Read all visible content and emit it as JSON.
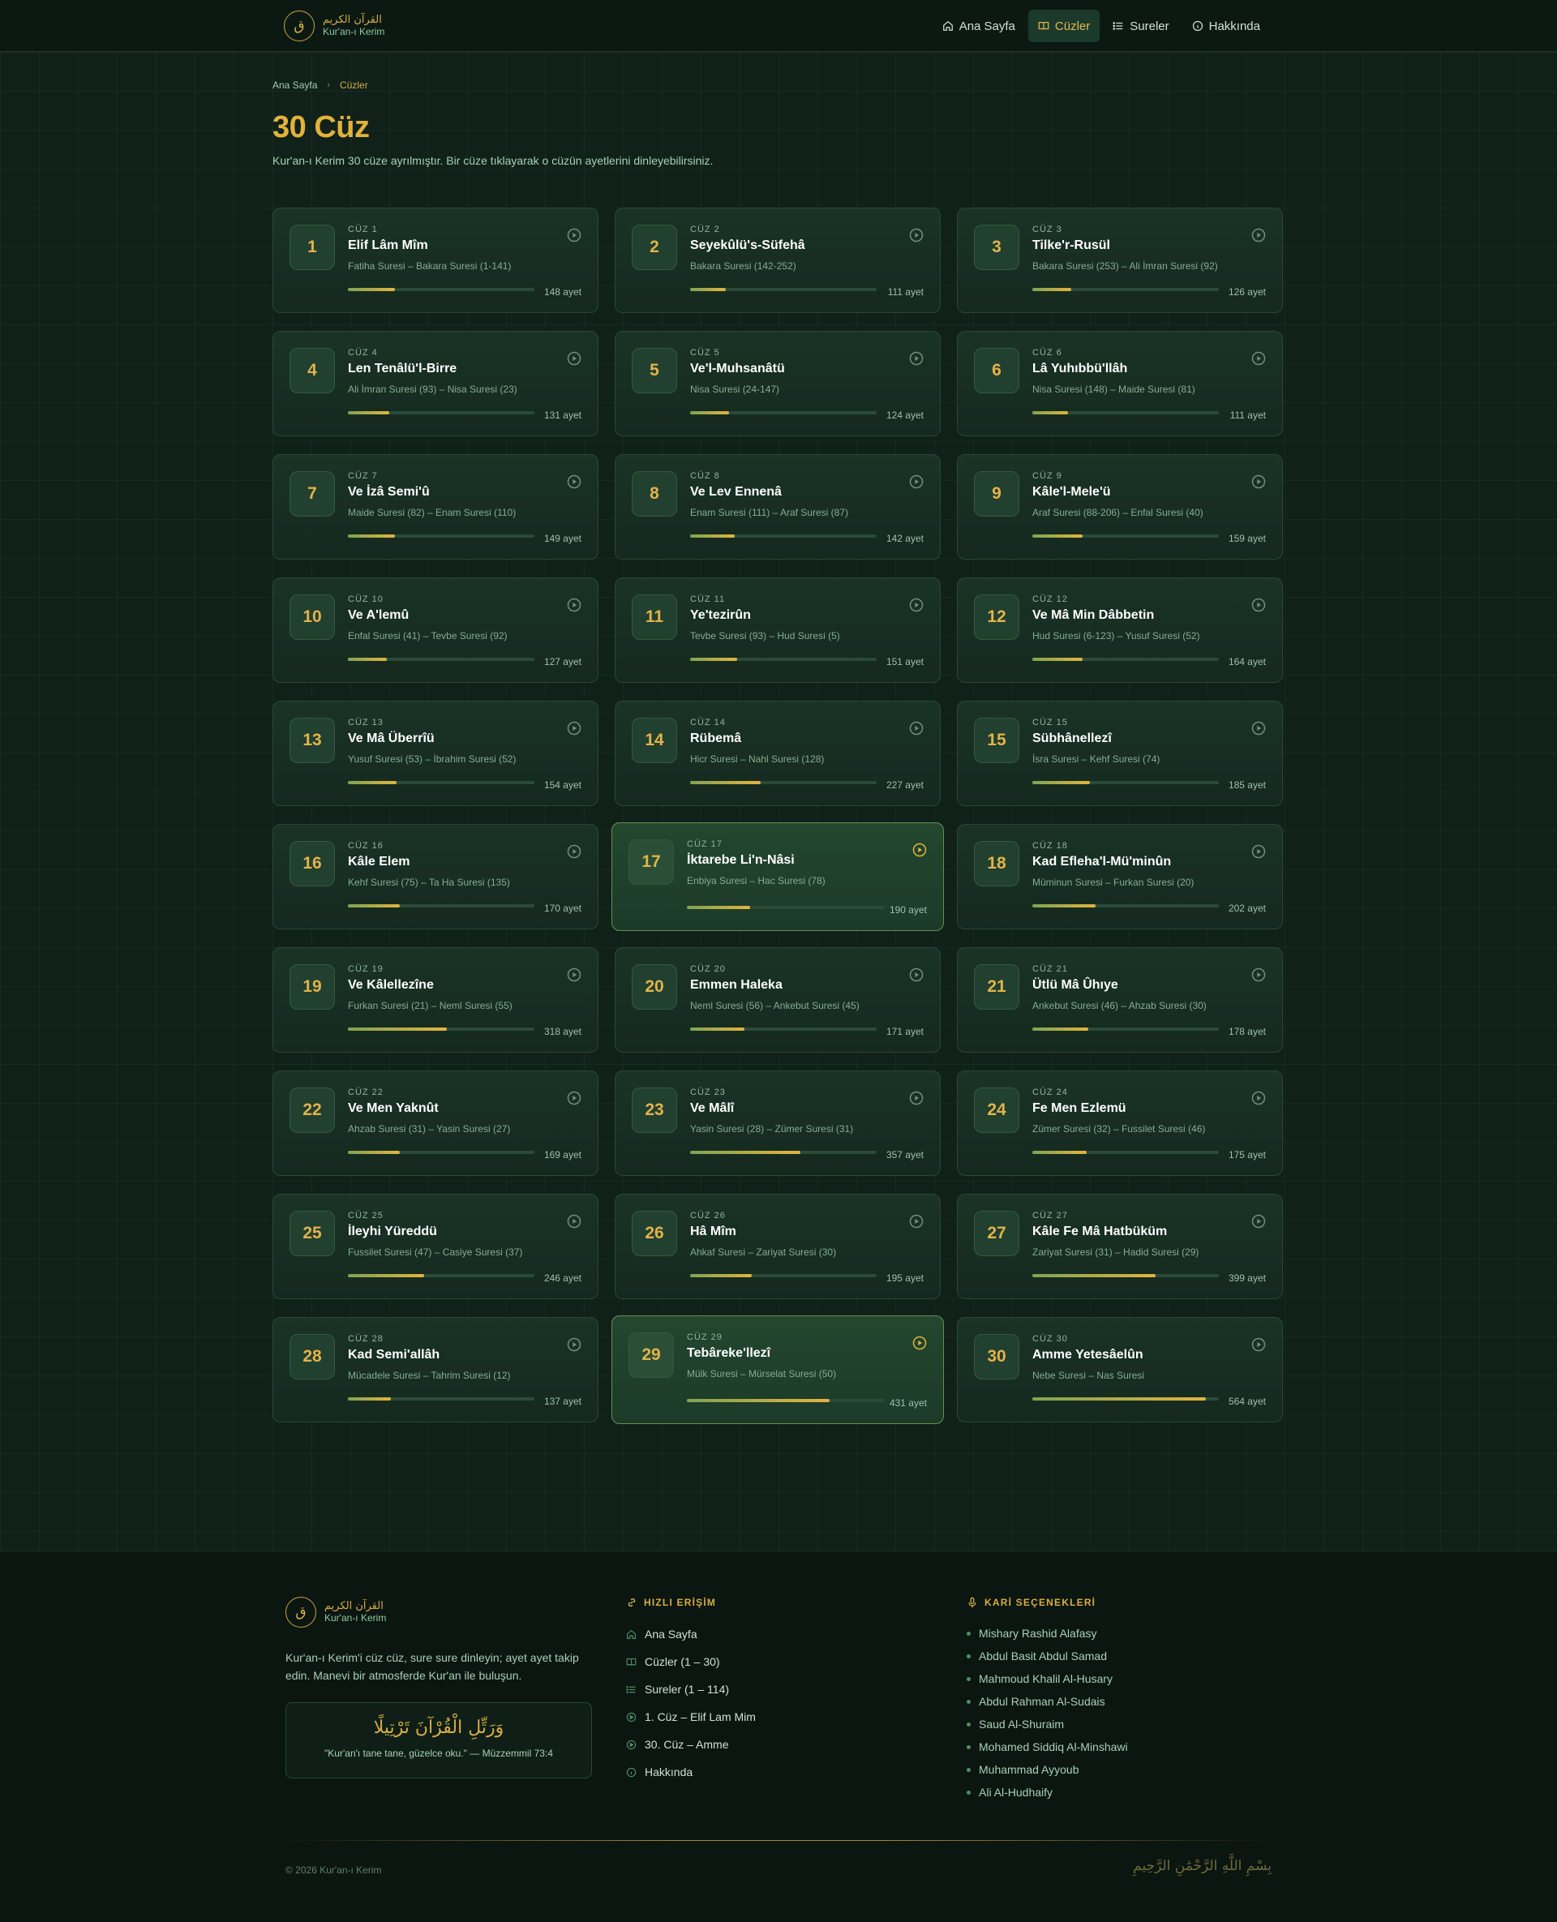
{
  "header": {
    "logo_letter": "ق",
    "brand_ar": "القرآن الكريم",
    "brand_tr": "Kur'an-ı Kerim",
    "nav": [
      {
        "label": "Ana Sayfa",
        "icon": "home-icon",
        "active": false
      },
      {
        "label": "Cüzler",
        "icon": "book-icon",
        "active": true
      },
      {
        "label": "Sureler",
        "icon": "list-icon",
        "active": false
      },
      {
        "label": "Hakkında",
        "icon": "info-icon",
        "active": false
      }
    ]
  },
  "breadcrumb": {
    "home": "Ana Sayfa",
    "separator": "›",
    "current": "Cüzler"
  },
  "page": {
    "title": "30 Cüz",
    "subtitle": "Kur'an-ı Kerim 30 cüze ayrılmıştır. Bir cüze tıklayarak o cüzün ayetlerini dinleyebilirsiniz."
  },
  "cuz_list": [
    {
      "number": "1",
      "label": "CÜZ 1",
      "name": "Elif Lâm Mîm",
      "range": "Fatiha Suresi – Bakara Suresi (1-141)",
      "ayet": "148 ayet",
      "progress": 0.25
    },
    {
      "number": "2",
      "label": "CÜZ 2",
      "name": "Seyekûlü's-Süfehâ",
      "range": "Bakara Suresi (142-252)",
      "ayet": "111 ayet",
      "progress": 0.19
    },
    {
      "number": "3",
      "label": "CÜZ 3",
      "name": "Tilke'r-Rusül",
      "range": "Bakara Suresi (253) – Ali İmran Suresi (92)",
      "ayet": "126 ayet",
      "progress": 0.21
    },
    {
      "number": "4",
      "label": "CÜZ 4",
      "name": "Len Tenâlü'l-Birre",
      "range": "Ali İmran Suresi (93) – Nisa Suresi (23)",
      "ayet": "131 ayet",
      "progress": 0.22
    },
    {
      "number": "5",
      "label": "CÜZ 5",
      "name": "Ve'l-Muhsanâtü",
      "range": "Nisa Suresi (24-147)",
      "ayet": "124 ayet",
      "progress": 0.21
    },
    {
      "number": "6",
      "label": "CÜZ 6",
      "name": "Lâ Yuhıbbü'llâh",
      "range": "Nisa Suresi (148) – Maide Suresi (81)",
      "ayet": "111 ayet",
      "progress": 0.19
    },
    {
      "number": "7",
      "label": "CÜZ 7",
      "name": "Ve İzâ Semi'û",
      "range": "Maide Suresi (82) – Enam Suresi (110)",
      "ayet": "149 ayet",
      "progress": 0.25
    },
    {
      "number": "8",
      "label": "CÜZ 8",
      "name": "Ve Lev Ennenâ",
      "range": "Enam Suresi (111) – Araf Suresi (87)",
      "ayet": "142 ayet",
      "progress": 0.24
    },
    {
      "number": "9",
      "label": "CÜZ 9",
      "name": "Kâle'l-Mele'ü",
      "range": "Araf Suresi (88-206) – Enfal Suresi (40)",
      "ayet": "159 ayet",
      "progress": 0.27
    },
    {
      "number": "10",
      "label": "CÜZ 10",
      "name": "Ve A'lemû",
      "range": "Enfal Suresi (41) – Tevbe Suresi (92)",
      "ayet": "127 ayet",
      "progress": 0.21
    },
    {
      "number": "11",
      "label": "CÜZ 11",
      "name": "Ye'tezirûn",
      "range": "Tevbe Suresi (93) – Hud Suresi (5)",
      "ayet": "151 ayet",
      "progress": 0.25
    },
    {
      "number": "12",
      "label": "CÜZ 12",
      "name": "Ve Mâ Min Dâbbetin",
      "range": "Hud Suresi (6-123) – Yusuf Suresi (52)",
      "ayet": "164 ayet",
      "progress": 0.27
    },
    {
      "number": "13",
      "label": "CÜZ 13",
      "name": "Ve Mâ Überrîü",
      "range": "Yusuf Suresi (53) – İbrahim Suresi (52)",
      "ayet": "154 ayet",
      "progress": 0.26
    },
    {
      "number": "14",
      "label": "CÜZ 14",
      "name": "Rübemâ",
      "range": "Hicr Suresi – Nahl Suresi (128)",
      "ayet": "227 ayet",
      "progress": 0.38
    },
    {
      "number": "15",
      "label": "CÜZ 15",
      "name": "Sübhânellezî",
      "range": "İsra Suresi – Kehf Suresi (74)",
      "ayet": "185 ayet",
      "progress": 0.31
    },
    {
      "number": "16",
      "label": "CÜZ 16",
      "name": "Kâle Elem",
      "range": "Kehf Suresi (75) – Ta Ha Suresi (135)",
      "ayet": "170 ayet",
      "progress": 0.28
    },
    {
      "number": "17",
      "label": "CÜZ 17",
      "name": "İktarebe Li'n-Nâsi",
      "range": "Enbiya Suresi – Hac Suresi (78)",
      "ayet": "190 ayet",
      "progress": 0.32,
      "active": true
    },
    {
      "number": "18",
      "label": "CÜZ 18",
      "name": "Kad Efleha'l-Mü'minûn",
      "range": "Müminun Suresi – Furkan Suresi (20)",
      "ayet": "202 ayet",
      "progress": 0.34
    },
    {
      "number": "19",
      "label": "CÜZ 19",
      "name": "Ve Kâlellezîne",
      "range": "Furkan Suresi (21) – Neml Suresi (55)",
      "ayet": "318 ayet",
      "progress": 0.53
    },
    {
      "number": "20",
      "label": "CÜZ 20",
      "name": "Emmen Haleka",
      "range": "Neml Suresi (56) – Ankebut Suresi (45)",
      "ayet": "171 ayet",
      "progress": 0.29
    },
    {
      "number": "21",
      "label": "CÜZ 21",
      "name": "Ütlü Mâ Ûhıye",
      "range": "Ankebut Suresi (46) – Ahzab Suresi (30)",
      "ayet": "178 ayet",
      "progress": 0.3
    },
    {
      "number": "22",
      "label": "CÜZ 22",
      "name": "Ve Men Yaknût",
      "range": "Ahzab Suresi (31) – Yasin Suresi (27)",
      "ayet": "169 ayet",
      "progress": 0.28
    },
    {
      "number": "23",
      "label": "CÜZ 23",
      "name": "Ve Mâlî",
      "range": "Yasin Suresi (28) – Zümer Suresi (31)",
      "ayet": "357 ayet",
      "progress": 0.59
    },
    {
      "number": "24",
      "label": "CÜZ 24",
      "name": "Fe Men Ezlemü",
      "range": "Zümer Suresi (32) – Fussilet Suresi (46)",
      "ayet": "175 ayet",
      "progress": 0.29
    },
    {
      "number": "25",
      "label": "CÜZ 25",
      "name": "İleyhi Yüreddü",
      "range": "Fussilet Suresi (47) – Casiye Suresi (37)",
      "ayet": "246 ayet",
      "progress": 0.41
    },
    {
      "number": "26",
      "label": "CÜZ 26",
      "name": "Hâ Mîm",
      "range": "Ahkaf Suresi – Zariyat Suresi (30)",
      "ayet": "195 ayet",
      "progress": 0.33
    },
    {
      "number": "27",
      "label": "CÜZ 27",
      "name": "Kâle Fe Mâ Hatbüküm",
      "range": "Zariyat Suresi (31) – Hadid Suresi (29)",
      "ayet": "399 ayet",
      "progress": 0.66
    },
    {
      "number": "28",
      "label": "CÜZ 28",
      "name": "Kad Semi'allâh",
      "range": "Mücadele Suresi – Tahrim Suresi (12)",
      "ayet": "137 ayet",
      "progress": 0.23
    },
    {
      "number": "29",
      "label": "CÜZ 29",
      "name": "Tebâreke'llezî",
      "range": "Mülk Suresi – Mürselat Suresi (50)",
      "ayet": "431 ayet",
      "progress": 0.72,
      "active": true
    },
    {
      "number": "30",
      "label": "CÜZ 30",
      "name": "Amme Yetesâelûn",
      "range": "Nebe Suresi – Nas Suresi",
      "ayet": "564 ayet",
      "progress": 0.93
    }
  ],
  "footer": {
    "brand_ar": "القرآن الكريم",
    "brand_tr": "Kur'an-ı Kerim",
    "logo_letter": "ق",
    "description": "Kur'an-ı Kerim'i cüz cüz, sure sure dinleyin; ayet ayet takip edin. Manevi bir atmosferde Kur'an ile buluşun.",
    "verse_ar": "وَرَتِّلِ الْقُرْآنَ تَرْتِيلًا",
    "verse_tr": "\"Kur'an'ı tane tane, güzelce oku.\" — Müzzemmil 73:4",
    "quick_title": "HIZLI ERİŞİM",
    "quick_links": [
      {
        "label": "Ana Sayfa",
        "icon": "home-icon"
      },
      {
        "label": "Cüzler (1 – 30)",
        "icon": "book-icon"
      },
      {
        "label": "Sureler (1 – 114)",
        "icon": "list-icon"
      },
      {
        "label": "1. Cüz – Elif Lam Mim",
        "icon": "play-icon"
      },
      {
        "label": "30. Cüz – Amme",
        "icon": "play-icon"
      },
      {
        "label": "Hakkında",
        "icon": "info-icon"
      }
    ],
    "reciters_title": "KARİ SEÇENEKLERİ",
    "reciters": [
      "Mishary Rashid Alafasy",
      "Abdul Basit Abdul Samad",
      "Mahmoud Khalil Al-Husary",
      "Abdul Rahman Al-Sudais",
      "Saud Al-Shuraim",
      "Mohamed Siddiq Al-Minshawi",
      "Muhammad Ayyoub",
      "Ali Al-Hudhaify"
    ],
    "copyright": "© 2026 Kur'an-ı Kerim",
    "basmala": "بِسْمِ اللَّهِ الرَّحْمَٰنِ الرَّحِيمِ"
  },
  "colors": {
    "accent": "#e2b23c",
    "bg": "#10211a",
    "card": "#1a3326",
    "green": "#8fc9a3"
  }
}
